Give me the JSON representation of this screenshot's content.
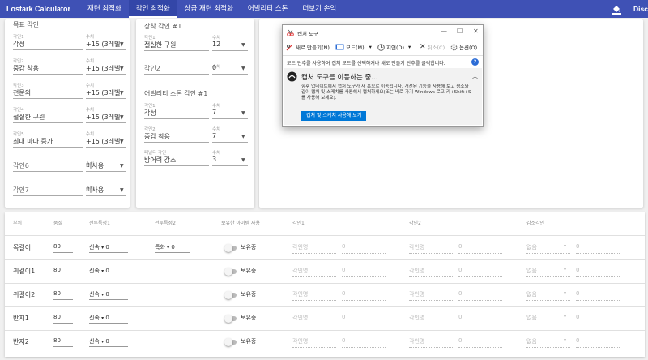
{
  "nav": {
    "brand": "Lostark Calculator",
    "tabs": [
      "재련 최적화",
      "각인 최적화",
      "상급 재련 최적화",
      "어빌리티 스톤",
      "더보기 손익"
    ],
    "active_tab": "각인 최적화",
    "right_text": "Disco",
    "bar_color": "#3f51b5"
  },
  "goal_card": {
    "title": "목표 각인",
    "rows": [
      {
        "label": "각인1",
        "value": "각성",
        "qty_label": "수치",
        "qty": "+15 (3레벨)"
      },
      {
        "label": "각인2",
        "value": "중갑 착용",
        "qty_label": "수치",
        "qty": "+15 (3레벨)"
      },
      {
        "label": "각인3",
        "value": "전문의",
        "qty_label": "수치",
        "qty": "+15 (3레벨)"
      },
      {
        "label": "각인4",
        "value": "절실한 구원",
        "qty_label": "수치",
        "qty": "+15 (3레벨)"
      },
      {
        "label": "각인5",
        "value": "최대 마나 증가",
        "qty_label": "수치",
        "qty": "+15 (3레벨)"
      },
      {
        "label": "",
        "value": "각인6",
        "qty_label": "수치",
        "qty": "미사용"
      },
      {
        "label": "",
        "value": "각인7",
        "qty_label": "수치",
        "qty": "미사용"
      }
    ]
  },
  "equip_card": {
    "title": "장착 각인 #1",
    "rows": [
      {
        "label": "각인1",
        "value": "절실한 구원",
        "qty_label": "수치",
        "qty": "12"
      },
      {
        "label": "",
        "value": "각인2",
        "qty_label": "수치",
        "qty": "0"
      }
    ],
    "stone_title": "어빌리티 스톤 각인 #1",
    "stone_rows": [
      {
        "label": "각인1",
        "value": "각성",
        "qty_label": "수치",
        "qty": "7"
      },
      {
        "label": "각인2",
        "value": "중갑 착용",
        "qty_label": "수치",
        "qty": "7"
      },
      {
        "label": "페널티 각인",
        "value": "방어력 감소",
        "qty_label": "수치",
        "qty": "3"
      }
    ]
  },
  "table": {
    "headers": [
      "부위",
      "품질",
      "전투특성1",
      "전투특성2",
      "보유한 아이템 사용",
      "각인1",
      "각인2",
      "감소각인"
    ],
    "rows": [
      {
        "part": "목걸이",
        "quality": "80",
        "stat1": "신속",
        "stat1_val": "0",
        "stat2": "특화",
        "stat2_val": "0",
        "owned": "보유중",
        "eng1": "각인명",
        "eng1_val": "0",
        "eng2": "각인명",
        "eng2_val": "0",
        "neg": "없음",
        "neg_val": "0"
      },
      {
        "part": "귀걸이1",
        "quality": "80",
        "stat1": "신속",
        "stat1_val": "0",
        "stat2": "",
        "stat2_val": "",
        "owned": "보유중",
        "eng1": "각인명",
        "eng1_val": "0",
        "eng2": "각인명",
        "eng2_val": "0",
        "neg": "없음",
        "neg_val": "0"
      },
      {
        "part": "귀걸이2",
        "quality": "80",
        "stat1": "신속",
        "stat1_val": "0",
        "stat2": "",
        "stat2_val": "",
        "owned": "보유중",
        "eng1": "각인명",
        "eng1_val": "0",
        "eng2": "각인명",
        "eng2_val": "0",
        "neg": "없음",
        "neg_val": "0"
      },
      {
        "part": "반지1",
        "quality": "80",
        "stat1": "신속",
        "stat1_val": "0",
        "stat2": "",
        "stat2_val": "",
        "owned": "보유중",
        "eng1": "각인명",
        "eng1_val": "0",
        "eng2": "각인명",
        "eng2_val": "0",
        "neg": "없음",
        "neg_val": "0"
      },
      {
        "part": "반지2",
        "quality": "80",
        "stat1": "신속",
        "stat1_val": "0",
        "stat2": "",
        "stat2_val": "",
        "owned": "보유중",
        "eng1": "각인명",
        "eng1_val": "0",
        "eng2": "각인명",
        "eng2_val": "0",
        "neg": "없음",
        "neg_val": "0"
      }
    ]
  },
  "snipping_tool": {
    "title": "캡처 도구",
    "toolbar": {
      "new": "새로 만들기(N)",
      "mode": "모드(M)",
      "delay": "지연(D)",
      "cancel": "취소(C)",
      "options": "옵션(O)"
    },
    "message": "모드 단추를 사용하여 캡처 모드를 선택하거나 새로 만들기 단추를 클릭합니다.",
    "notice_title": "캡처 도구를 이동하는 중...",
    "notice_body": "향후 업데이트에서 캡처 도구가 새 홈으로 이동됩니다. 개선된 기능을 사용해 보고 평소와 같이 캡처 및 스케치를 사용해서 캡처하세요(또는 바로 가기 Windows 로고 키+Shift+S를 사용해 보세요).",
    "notice_button": "캡처 및 스케치 사용해 보기",
    "accent": "#0078d7"
  }
}
